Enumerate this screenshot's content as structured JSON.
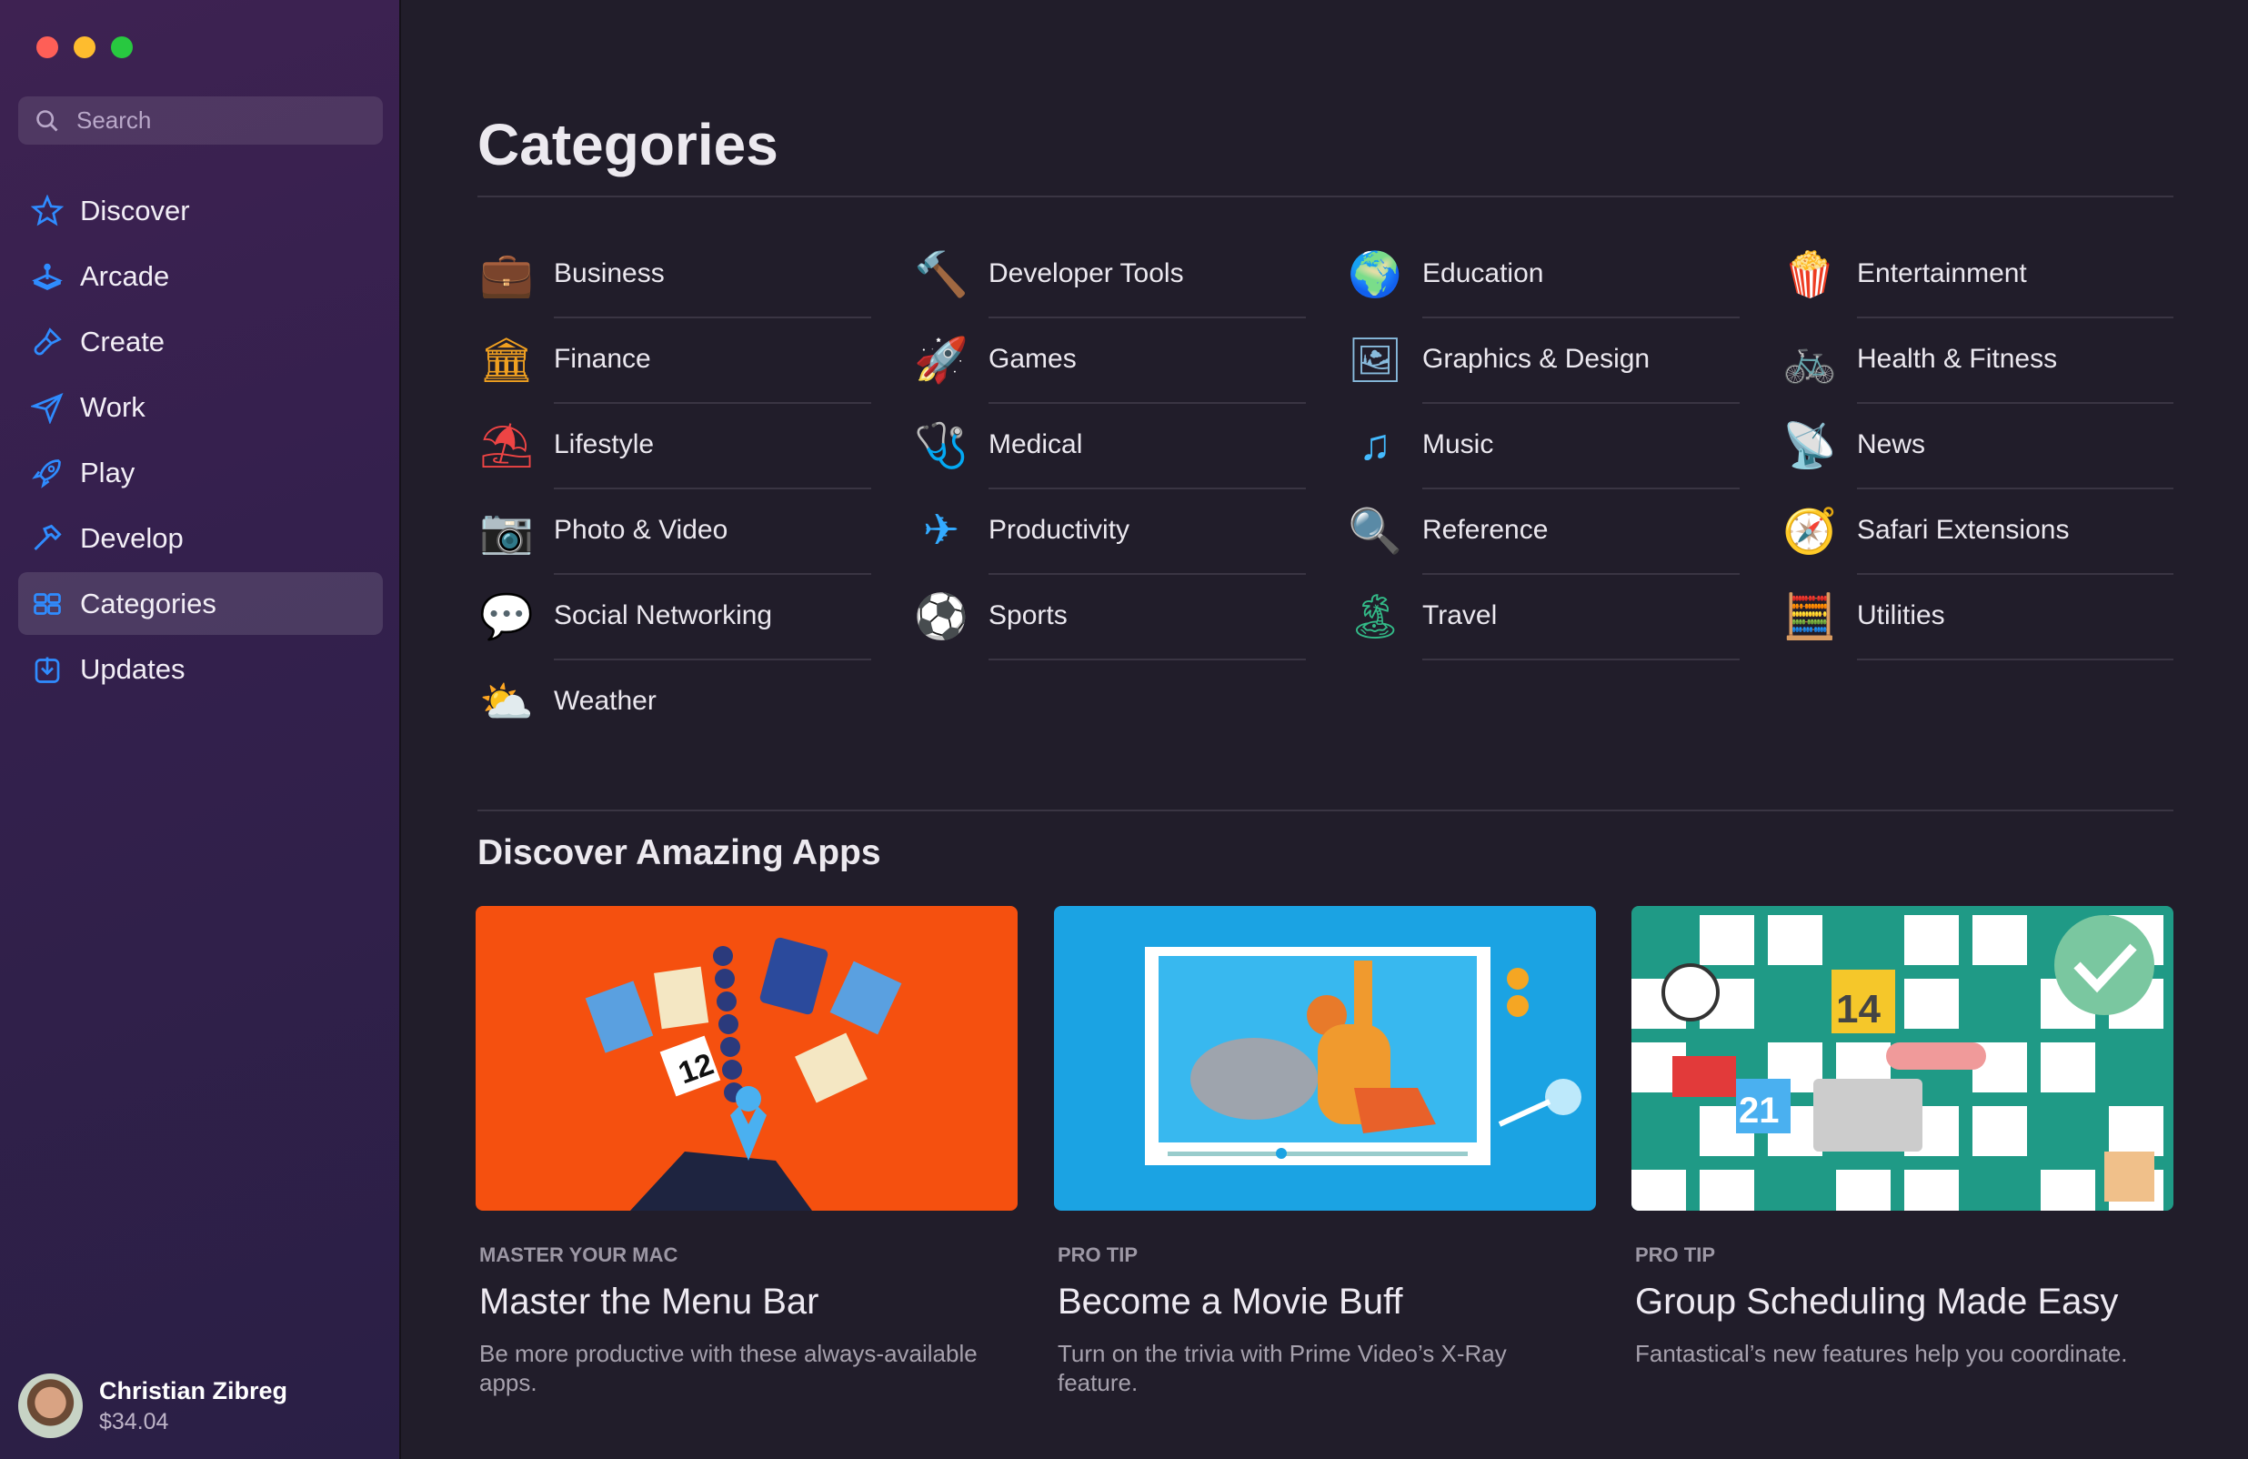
{
  "window": {
    "controls": [
      "close",
      "minimize",
      "zoom"
    ]
  },
  "sidebar": {
    "search_placeholder": "Search",
    "items": [
      {
        "label": "Discover",
        "icon": "star-icon"
      },
      {
        "label": "Arcade",
        "icon": "joystick-icon"
      },
      {
        "label": "Create",
        "icon": "paintbrush-icon"
      },
      {
        "label": "Work",
        "icon": "paperplane-icon"
      },
      {
        "label": "Play",
        "icon": "rocket-icon"
      },
      {
        "label": "Develop",
        "icon": "hammer-icon"
      },
      {
        "label": "Categories",
        "icon": "grid-icon",
        "selected": true
      },
      {
        "label": "Updates",
        "icon": "download-icon"
      }
    ],
    "user": {
      "name": "Christian Zibreg",
      "balance": "$34.04"
    },
    "accent": "#2f8cff"
  },
  "main": {
    "title": "Categories",
    "categories": [
      {
        "label": "Business",
        "icon": "briefcase-icon"
      },
      {
        "label": "Developer Tools",
        "icon": "hammer-icon"
      },
      {
        "label": "Education",
        "icon": "globe-icon"
      },
      {
        "label": "Entertainment",
        "icon": "popcorn-icon"
      },
      {
        "label": "Finance",
        "icon": "bank-icon"
      },
      {
        "label": "Games",
        "icon": "rocket-icon"
      },
      {
        "label": "Graphics & Design",
        "icon": "picture-icon"
      },
      {
        "label": "Health & Fitness",
        "icon": "bicycle-icon"
      },
      {
        "label": "Lifestyle",
        "icon": "beach-chair-icon"
      },
      {
        "label": "Medical",
        "icon": "stethoscope-icon"
      },
      {
        "label": "Music",
        "icon": "music-note-icon"
      },
      {
        "label": "News",
        "icon": "satellite-dish-icon"
      },
      {
        "label": "Photo & Video",
        "icon": "camera-icon"
      },
      {
        "label": "Productivity",
        "icon": "paperplane-icon"
      },
      {
        "label": "Reference",
        "icon": "magnifier-icon"
      },
      {
        "label": "Safari Extensions",
        "icon": "compass-icon"
      },
      {
        "label": "Social Networking",
        "icon": "chat-heart-icon"
      },
      {
        "label": "Sports",
        "icon": "soccer-ball-icon"
      },
      {
        "label": "Travel",
        "icon": "palm-island-icon"
      },
      {
        "label": "Utilities",
        "icon": "calculator-icon"
      },
      {
        "label": "Weather",
        "icon": "sun-cloud-icon"
      }
    ],
    "discover_title": "Discover Amazing Apps",
    "cards": [
      {
        "eyebrow": "MASTER YOUR MAC",
        "title": "Master the Menu Bar",
        "desc": "Be more productive with these always-available apps.",
        "color": "#f5500f"
      },
      {
        "eyebrow": "PRO TIP",
        "title": "Become a Movie Buff",
        "desc": "Turn on the trivia with Prime Video’s X-Ray feature.",
        "color": "#1ba3e3"
      },
      {
        "eyebrow": "PRO TIP",
        "title": "Group Scheduling Made Easy",
        "desc": "Fantastical’s new features help you coordinate.",
        "color": "#1f9a86"
      }
    ]
  }
}
